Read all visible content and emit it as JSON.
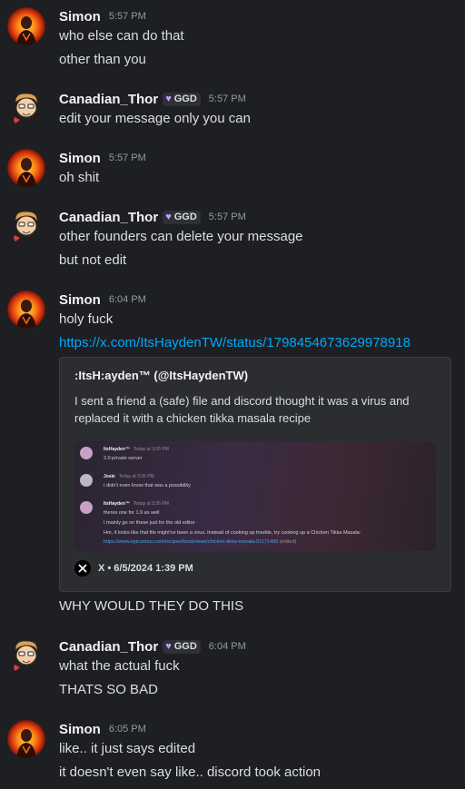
{
  "colors": {
    "background": "#1e1f22",
    "link": "#00a8fc",
    "badge_heart": "#c79cff"
  },
  "messages": [
    {
      "author": "Simon",
      "time": "5:57 PM",
      "lines": [
        "who else can do that",
        "other than you"
      ]
    },
    {
      "author": "Canadian_Thor",
      "badge": "GGD",
      "time": "5:57 PM",
      "lines": [
        "edit your message only you can"
      ]
    },
    {
      "author": "Simon",
      "time": "5:57 PM",
      "lines": [
        "oh shit"
      ]
    },
    {
      "author": "Canadian_Thor",
      "badge": "GGD",
      "time": "5:57 PM",
      "lines": [
        "other founders can delete your message",
        "but not edit"
      ]
    },
    {
      "author": "Simon",
      "time": "6:04 PM",
      "lines": [
        "holy fuck"
      ],
      "link": "https://x.com/ItsHaydenTW/status/1798454673629978918",
      "after_embed": "WHY WOULD THEY DO THIS"
    },
    {
      "author": "Canadian_Thor",
      "badge": "GGD",
      "time": "6:04 PM",
      "lines": [
        "what the actual fuck",
        "THATS SO BAD"
      ]
    },
    {
      "author": "Simon",
      "time": "6:05 PM",
      "lines": [
        "like.. it just says edited",
        "it doesn't even say like.. discord took action"
      ]
    }
  ],
  "embed": {
    "author": ":ItsH:ayden™ (@ItsHaydenTW)",
    "description": "I sent a friend a (safe) file and discord thought it was a virus and replaced it with a chicken tikka masala recipe",
    "footer": "X • 6/5/2024 1:39 PM",
    "icon": "x-logo-icon",
    "screenshot": {
      "rows": [
        {
          "name": "ItsHayden™",
          "time": "Today at 3:26 PM",
          "lines": [
            "2.0 private server"
          ]
        },
        {
          "name": "Josie",
          "time": "Today at 3:26 PM",
          "lines": [
            "I didn't even know that was a possibility"
          ]
        },
        {
          "name": "ItsHayden™",
          "time": "Today at 3:26 PM",
          "lines": [
            "theres one for 1.9 as well",
            "I mainly go on these just for the old editor",
            "Hm, it looks like that file might've been a virus. Instead of cooking up trouble, try cooking up a Chicken Tikka Masala:"
          ],
          "link": "https://www.epicurious.com/recipes/food/views/chicken-tikka-masala-51171400",
          "link_suffix": "(edited)"
        }
      ]
    }
  }
}
